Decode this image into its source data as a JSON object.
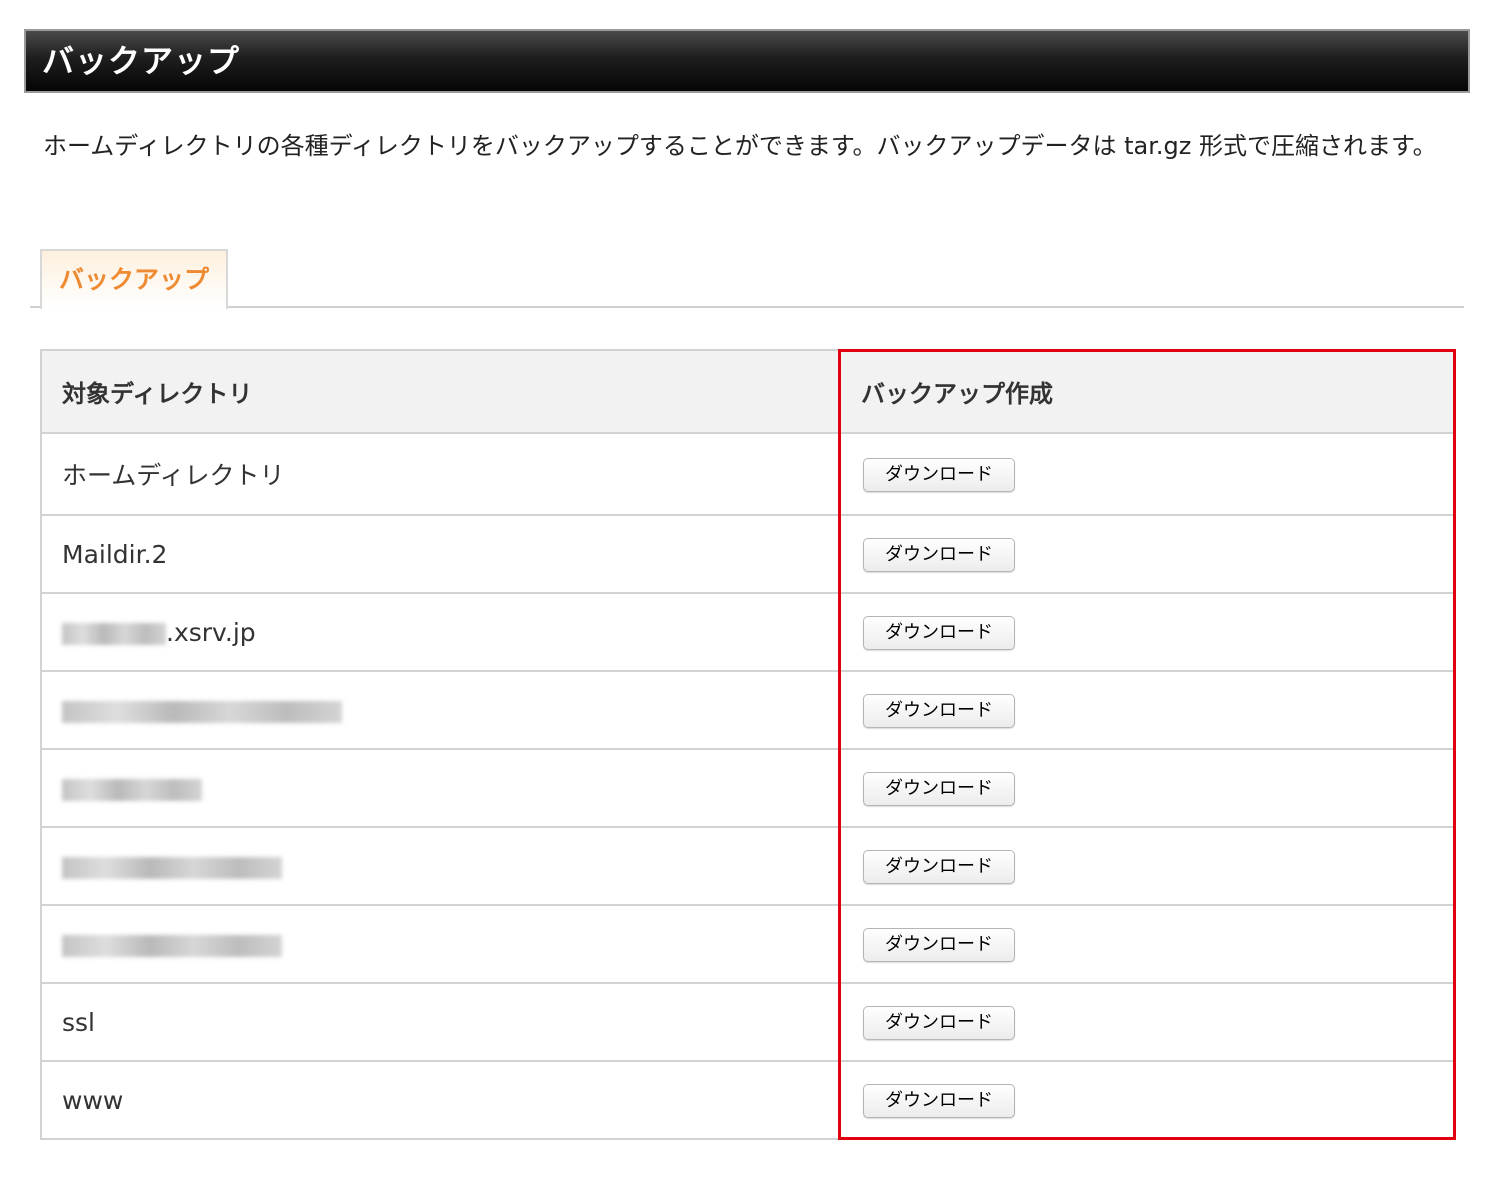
{
  "header": {
    "title": "バックアップ"
  },
  "description": "ホームディレクトリの各種ディレクトリをバックアップすることができます。バックアップデータは tar.gz 形式で圧縮されます。",
  "tabs": [
    {
      "label": "バックアップ",
      "active": true
    }
  ],
  "table": {
    "columns": [
      "対象ディレクトリ",
      "バックアップ作成"
    ],
    "rows": [
      {
        "directory": "ホームディレクトリ",
        "blurred": false,
        "button_label": "ダウンロード"
      },
      {
        "directory": "Maildir.2",
        "blurred": false,
        "button_label": "ダウンロード"
      },
      {
        "directory": ".xsrv.jp",
        "blurred": "partial",
        "button_label": "ダウンロード"
      },
      {
        "directory": "",
        "blurred": true,
        "button_label": "ダウンロード"
      },
      {
        "directory": "",
        "blurred": true,
        "button_label": "ダウンロード"
      },
      {
        "directory": "",
        "blurred": true,
        "button_label": "ダウンロード"
      },
      {
        "directory": "",
        "blurred": true,
        "button_label": "ダウンロード"
      },
      {
        "directory": "ssl",
        "blurred": false,
        "button_label": "ダウンロード"
      },
      {
        "directory": "www",
        "blurred": false,
        "button_label": "ダウンロード"
      }
    ]
  },
  "colors": {
    "tab_active_text": "#ee8a32",
    "highlight_border": "#e0000f",
    "header_background": "#1e1e1e"
  }
}
